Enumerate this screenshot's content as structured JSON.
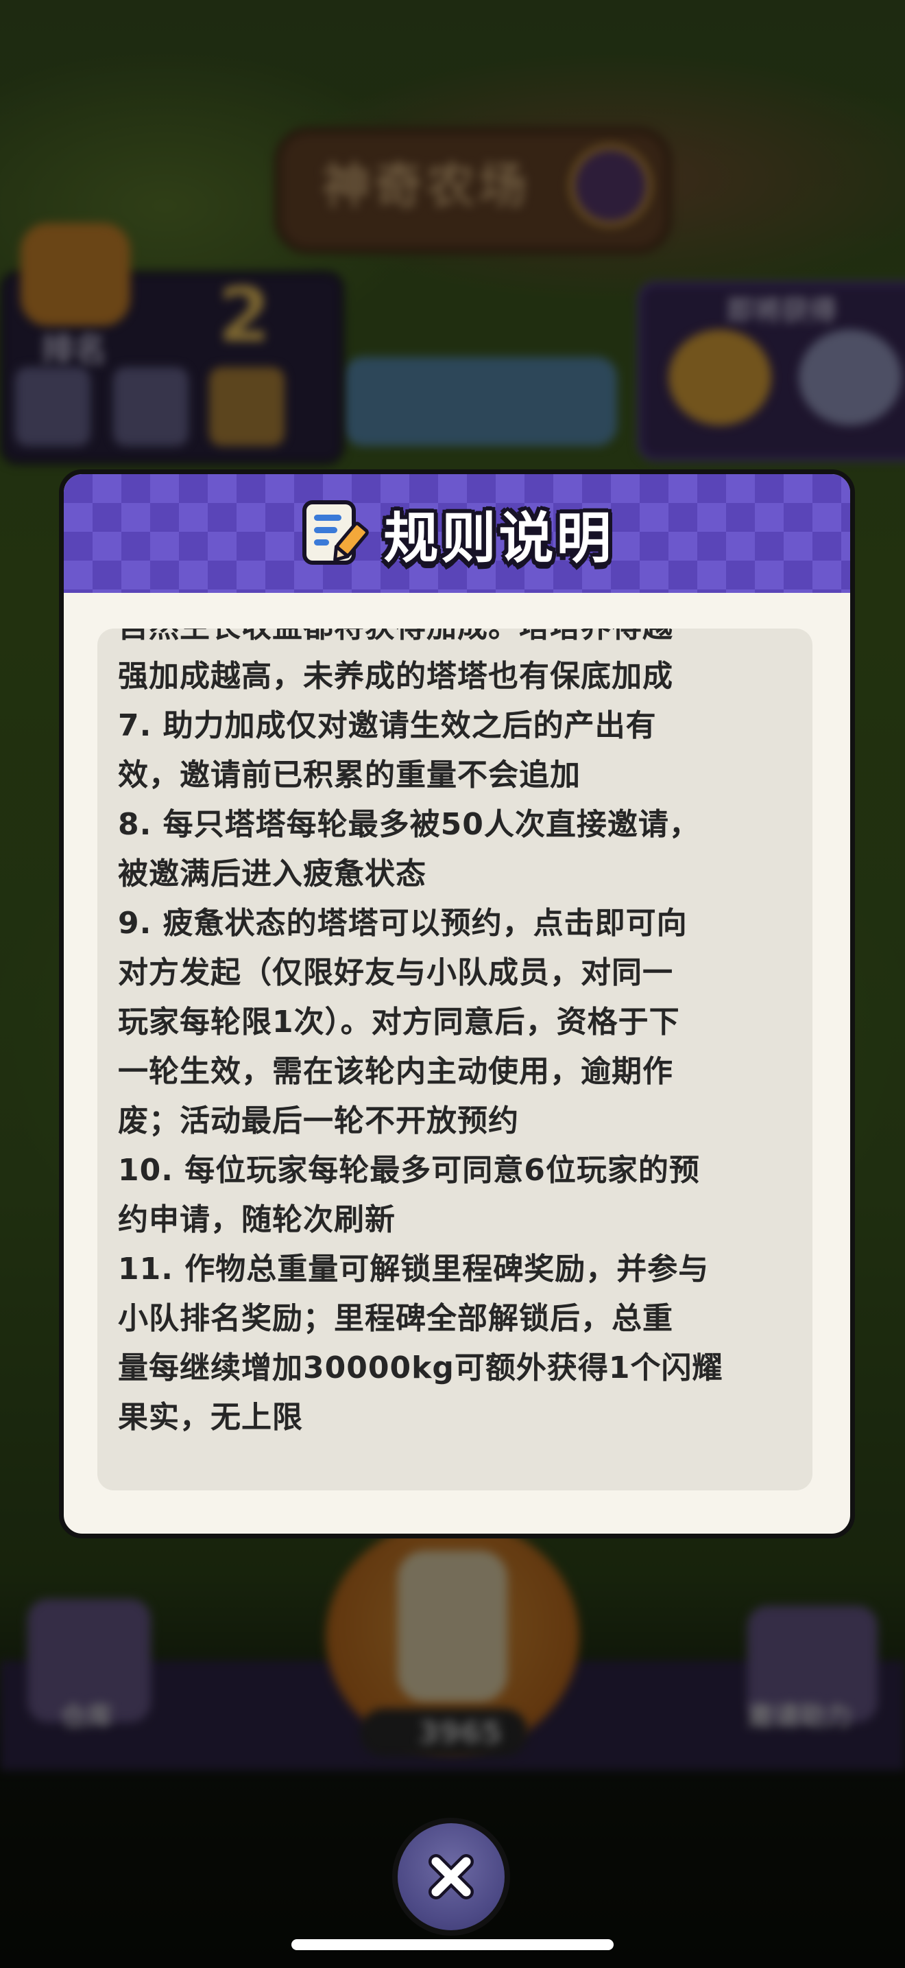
{
  "background": {
    "game_title": "神奇农场",
    "rank_label": "排名",
    "rank_value": "2",
    "panel_label": "即将获得",
    "counter_value": "3965",
    "left_button_label": "仓库",
    "right_button_label": "邀请助力"
  },
  "modal": {
    "title": "规则说明",
    "lines": [
      "自然生长收益都将获得加成。塔塔养得越",
      "强加成越高，未养成的塔塔也有保底加成",
      "7. 助力加成仅对邀请生效之后的产出有",
      "效，邀请前已积累的重量不会追加",
      "8. 每只塔塔每轮最多被50人次直接邀请，",
      "被邀满后进入疲惫状态",
      "9. 疲惫状态的塔塔可以预约，点击即可向",
      "对方发起（仅限好友与小队成员，对同一",
      "玩家每轮限1次）。对方同意后，资格于下",
      "一轮生效，需在该轮内主动使用，逾期作",
      "废；活动最后一轮不开放预约",
      "10. 每位玩家每轮最多可同意6位玩家的预",
      "约申请，随轮次刷新",
      "11. 作物总重量可解锁里程碑奖励，并参与",
      "小队排名奖励；里程碑全部解锁后，总重",
      "量每继续增加30000kg可额外获得1个闪耀",
      "果实，无上限"
    ]
  },
  "icons": {
    "title_icon": "document-pencil-icon",
    "close_icon": "close-icon"
  },
  "colors": {
    "header_purple": "#5a45b8",
    "content_bg": "#e6e3da",
    "modal_bg": "#f7f4ec",
    "close_button": "#4d4a86"
  }
}
